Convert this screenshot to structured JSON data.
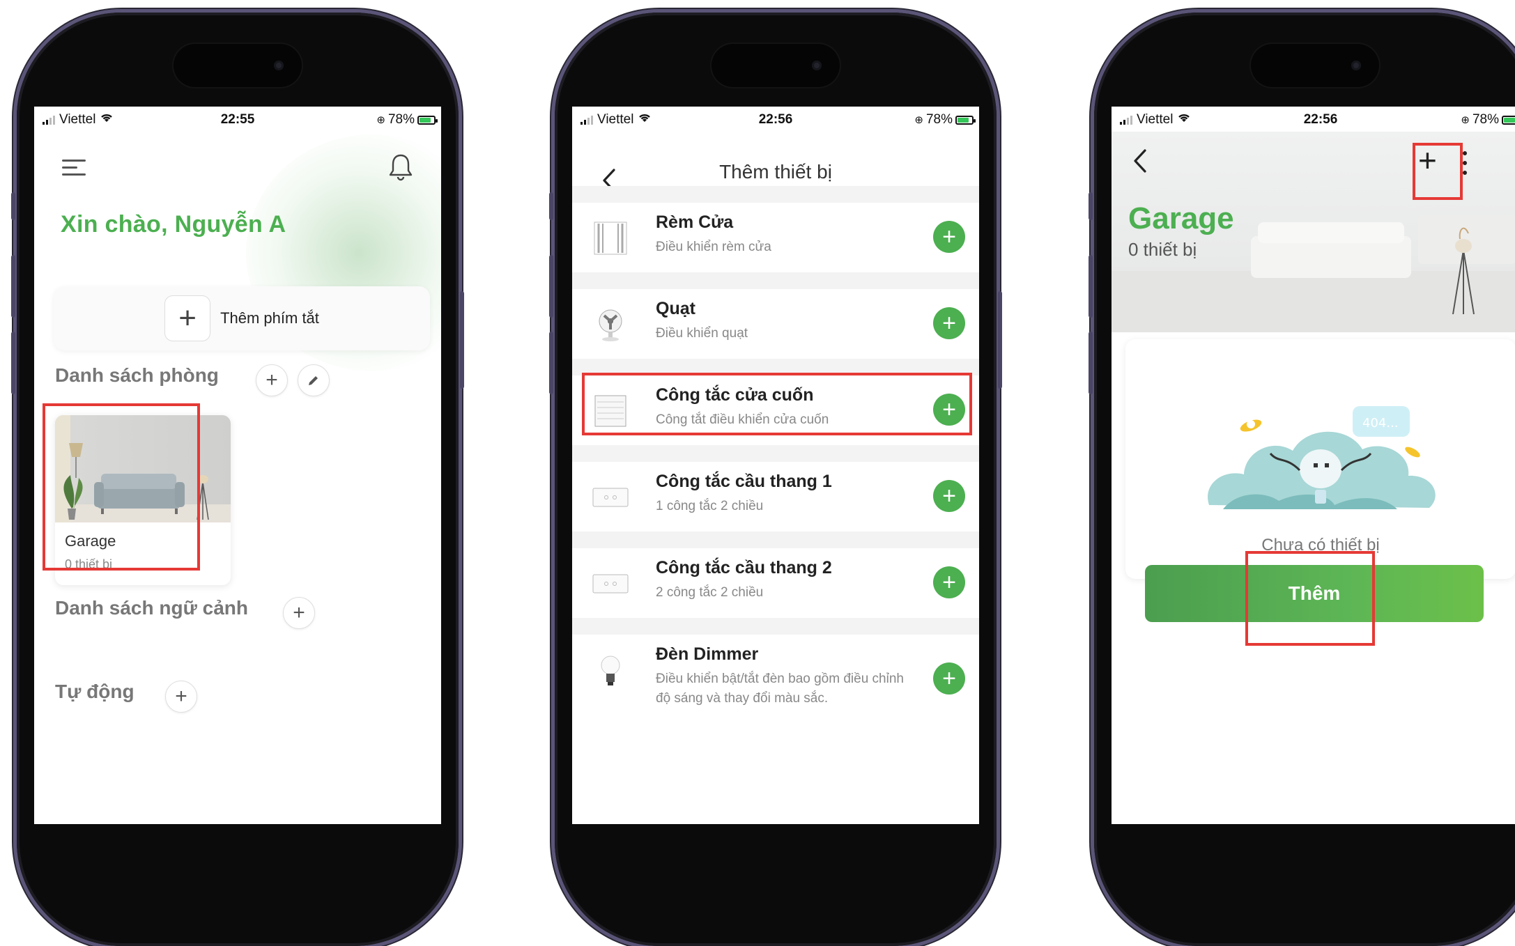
{
  "status_bar": {
    "carrier": "Viettel",
    "battery": "78%",
    "battery_level": 0.78,
    "times": [
      "22:55",
      "22:56",
      "22:56"
    ]
  },
  "screen1": {
    "greeting": "Xin chào, Nguyễn A",
    "add_shortcut_label": "Thêm phím tắt",
    "rooms_section": "Danh sách phòng",
    "room": {
      "name": "Garage",
      "count": "0 thiết bị"
    },
    "scenes_section": "Danh sách ngữ cảnh",
    "automation_section": "Tự động"
  },
  "screen2": {
    "title": "Thêm thiết bị",
    "devices": [
      {
        "title": "Rèm Cửa",
        "subtitle": "Điều khiển rèm cửa",
        "icon": "curtain-icon"
      },
      {
        "title": "Quạt",
        "subtitle": "Điều khiển quạt",
        "icon": "fan-icon"
      },
      {
        "title": "Công tắc cửa cuốn",
        "subtitle": "Công tắt điều khiển cửa cuốn",
        "icon": "rolling-door-icon",
        "highlighted": true
      },
      {
        "title": "Công tắc cầu thang 1",
        "subtitle": "1 công tắc 2 chiều",
        "icon": "switch-icon"
      },
      {
        "title": "Công tắc cầu thang 2",
        "subtitle": "2 công tắc 2 chiều",
        "icon": "switch-icon"
      },
      {
        "title": "Đèn Dimmer",
        "subtitle": "Điều khiển bật/tắt đèn bao gồm điều chỉnh độ sáng và thay đổi màu sắc.",
        "icon": "bulb-icon"
      }
    ]
  },
  "screen3": {
    "room_title": "Garage",
    "device_count": "0 thiết bị",
    "empty_badge": "404...",
    "empty_text": "Chưa có thiết bị",
    "add_button": "Thêm"
  },
  "colors": {
    "accent_green": "#4caf50",
    "highlight_red": "#e53935",
    "phone_frame": "#5b5578"
  }
}
